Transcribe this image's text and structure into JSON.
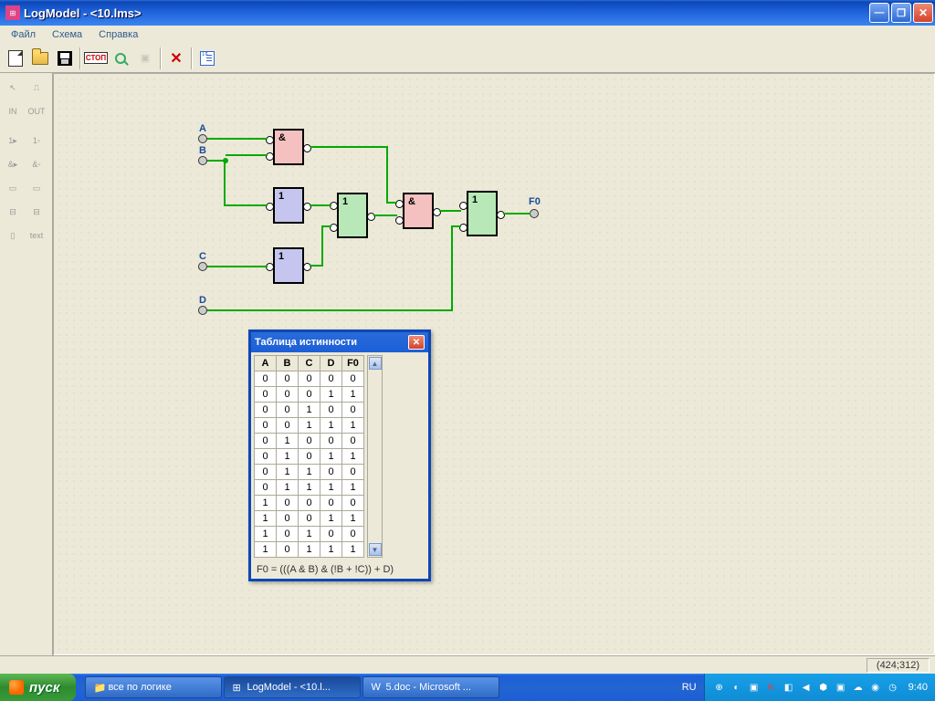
{
  "title": "LogModel - <10.lms>",
  "menu": {
    "file": "Файл",
    "schema": "Схема",
    "help": "Справка"
  },
  "toolbar": {
    "stop": "СТОП"
  },
  "side": {
    "in": "IN",
    "out": "OUT",
    "text": "text"
  },
  "status": {
    "coords": "(424;312)"
  },
  "diagram": {
    "inputs": {
      "a": "A",
      "b": "B",
      "c": "C",
      "d": "D"
    },
    "output": "F0",
    "gate_and": "&",
    "gate_or": "1"
  },
  "truth": {
    "title": "Таблица истинности",
    "headers": [
      "A",
      "B",
      "C",
      "D",
      "F0"
    ],
    "rows": [
      [
        "0",
        "0",
        "0",
        "0",
        "0"
      ],
      [
        "0",
        "0",
        "0",
        "1",
        "1"
      ],
      [
        "0",
        "0",
        "1",
        "0",
        "0"
      ],
      [
        "0",
        "0",
        "1",
        "1",
        "1"
      ],
      [
        "0",
        "1",
        "0",
        "0",
        "0"
      ],
      [
        "0",
        "1",
        "0",
        "1",
        "1"
      ],
      [
        "0",
        "1",
        "1",
        "0",
        "0"
      ],
      [
        "0",
        "1",
        "1",
        "1",
        "1"
      ],
      [
        "1",
        "0",
        "0",
        "0",
        "0"
      ],
      [
        "1",
        "0",
        "0",
        "1",
        "1"
      ],
      [
        "1",
        "0",
        "1",
        "0",
        "0"
      ],
      [
        "1",
        "0",
        "1",
        "1",
        "1"
      ]
    ],
    "formula": "F0 = (((A & B) & (!B + !C)) + D)"
  },
  "taskbar": {
    "start": "пуск",
    "items": [
      {
        "label": "все по логике"
      },
      {
        "label": "LogModel - <10.l..."
      },
      {
        "label": "5.doc - Microsoft ..."
      }
    ],
    "lang": "RU",
    "clock": "9:40"
  }
}
